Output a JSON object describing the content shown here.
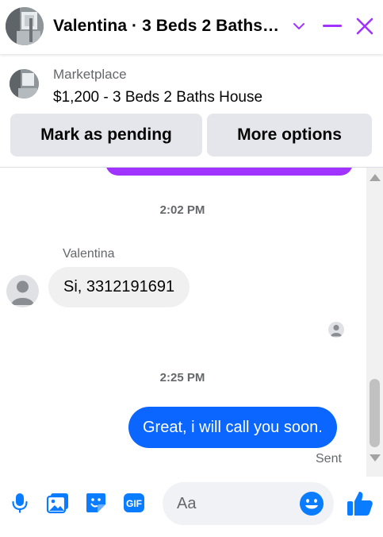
{
  "header": {
    "title": "Valentina · 3 Beds 2 Baths House",
    "icons": {
      "chevron": "chevron-down-icon",
      "minimize": "minimize-icon",
      "close": "close-icon"
    },
    "accent_color": "#a033ff"
  },
  "listing": {
    "source": "Marketplace",
    "title": "$1,200 - 3 Beds 2 Baths House",
    "buttons": {
      "pending": "Mark as pending",
      "more": "More options"
    }
  },
  "conversation": {
    "timestamp_1": "2:02 PM",
    "sender_name": "Valentina",
    "incoming_message": "Si, 3312191691",
    "timestamp_2": "2:25 PM",
    "outgoing_message": "Great, i will call you soon.",
    "status": "Sent",
    "colors": {
      "outgoing_bubble": "#0a66ff",
      "incoming_bubble": "#f0f0f0"
    }
  },
  "composer": {
    "placeholder": "Aa",
    "value": "",
    "icons": [
      "microphone-icon",
      "photo-icon",
      "sticker-icon",
      "gif-icon",
      "emoji-icon",
      "thumbs-up-icon"
    ],
    "icon_color": "#0a7cff"
  }
}
